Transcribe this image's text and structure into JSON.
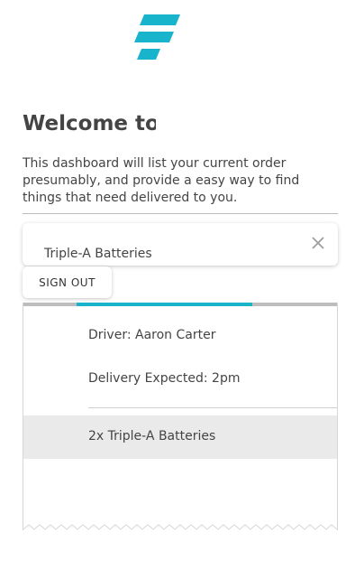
{
  "brand": {
    "logo_icon": "stacked-stripes-logo-icon",
    "accent": "#17b4cc"
  },
  "welcome": {
    "title": "Welcome to",
    "description": "This dashboard will list your current order presumably, and provide a easy way to find things that need delivered to you."
  },
  "order_card": {
    "name": "Triple-A Batteries",
    "close_icon": "close-icon"
  },
  "signout": {
    "label": "SIGN OUT"
  },
  "delivery": {
    "progress": {
      "start": 0.17,
      "end": 0.73
    },
    "driver": "Driver: Aaron Carter",
    "expected": "Delivery Expected: 2pm",
    "items": [
      "2x Triple-A Batteries"
    ]
  },
  "colors": {
    "text": "#444444",
    "track": "#bdbdbd",
    "row_highlight": "#eaeaea"
  }
}
